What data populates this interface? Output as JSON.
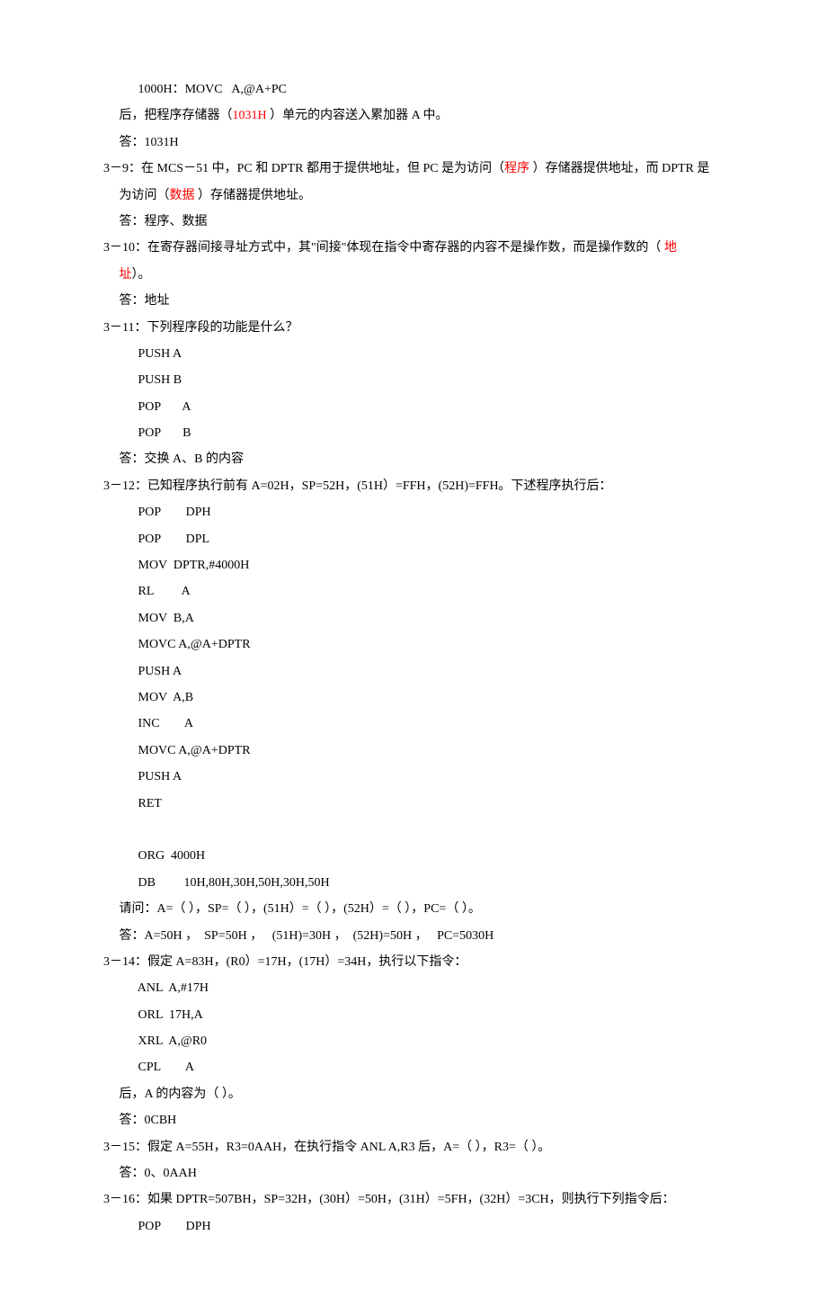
{
  "r1": {
    "indent": "           ",
    "a": "1000H：MOVC   A,@A+PC"
  },
  "r2": {
    "indent": "     ",
    "a": "后，把程序存储器（",
    "b": "1031H ",
    "c": "）单元的内容送入累加器 A 中。"
  },
  "r3": {
    "indent": "     ",
    "a": "答：1031H"
  },
  "r4": {
    "indent": "",
    "a": "3－9：在 MCS－51 中，PC 和 DPTR 都用于提供地址，但 PC 是为访问（",
    "b": "程序 ",
    "c": "）存储器提供地址，而 DPTR 是"
  },
  "r5": {
    "indent": "     ",
    "a": "为访问（",
    "b": "数据 ",
    "c": "）存储器提供地址。"
  },
  "r6": {
    "indent": "     ",
    "a": "答：程序、数据"
  },
  "r7": {
    "indent": "",
    "a": "3－10：在寄存器间接寻址方式中，其\"间接\"体现在指令中寄存器的内容不是操作数，而是操作数的（ ",
    "b": "地"
  },
  "r8": {
    "indent": "     ",
    "a": "址",
    "b": "）。"
  },
  "r9": {
    "indent": "     ",
    "a": "答：地址"
  },
  "r10": {
    "indent": "",
    "a": "3－11：下列程序段的功能是什么？"
  },
  "r11": {
    "indent": "           ",
    "a": "PUSH A"
  },
  "r12": {
    "indent": "           ",
    "a": "PUSH B"
  },
  "r13": {
    "indent": "           ",
    "a": "POP       A"
  },
  "r14": {
    "indent": "           ",
    "a": "POP       B"
  },
  "r15": {
    "indent": "     ",
    "a": "答：交换 A、B 的内容"
  },
  "r16": {
    "indent": "",
    "a": "3－12：已知程序执行前有 A=02H，SP=52H，(51H）=FFH，(52H)=FFH。下述程序执行后："
  },
  "r17": {
    "indent": "           ",
    "a": "POP        DPH"
  },
  "r18": {
    "indent": "           ",
    "a": "POP        DPL"
  },
  "r19": {
    "indent": "           ",
    "a": "MOV  DPTR,#4000H"
  },
  "r20": {
    "indent": "           ",
    "a": "RL         A"
  },
  "r21": {
    "indent": "           ",
    "a": "MOV  B,A"
  },
  "r22": {
    "indent": "           ",
    "a": "MOVC A,@A+DPTR"
  },
  "r23": {
    "indent": "           ",
    "a": "PUSH A"
  },
  "r24": {
    "indent": "           ",
    "a": "MOV  A,B"
  },
  "r25": {
    "indent": "           ",
    "a": "INC        A"
  },
  "r26": {
    "indent": "           ",
    "a": "MOVC A,@A+DPTR"
  },
  "r27": {
    "indent": "           ",
    "a": "PUSH A"
  },
  "r28": {
    "indent": "           ",
    "a": "RET"
  },
  "r29": {
    "indent": "           ",
    "a": ""
  },
  "r30": {
    "indent": "           ",
    "a": "ORG  4000H"
  },
  "r31": {
    "indent": "           ",
    "a": "DB         10H,80H,30H,50H,30H,50H"
  },
  "r32": {
    "indent": "     ",
    "a": "请问：A=（ ），SP=（ ），(51H）=（ ），(52H）=（ ），PC=（ ）。"
  },
  "r33": {
    "indent": "     ",
    "a": "答：A=50H ，  SP=50H ，   (51H)=30H ，  (52H)=50H ，   PC=5030H"
  },
  "r34": {
    "indent": "",
    "a": "3－14：假定 A=83H，(R0）=17H，(17H）=34H，执行以下指令："
  },
  "r35": {
    "indent": "           ",
    "a": "ANL  A,#17H"
  },
  "r36": {
    "indent": "           ",
    "a": "ORL  17H,A"
  },
  "r37": {
    "indent": "           ",
    "a": "XRL  A,@R0"
  },
  "r38": {
    "indent": "           ",
    "a": "CPL        A"
  },
  "r39": {
    "indent": "     ",
    "a": "后，A 的内容为（ ）。"
  },
  "r40": {
    "indent": "     ",
    "a": "答：0CBH"
  },
  "r41": {
    "indent": "",
    "a": "3－15：假定 A=55H，R3=0AAH，在执行指令 ANL A,R3 后，A=（ ），R3=（ ）。"
  },
  "r42": {
    "indent": "     ",
    "a": "答：0、0AAH"
  },
  "r43": {
    "indent": "",
    "a": "3－16：如果 DPTR=507BH，SP=32H，(30H）=50H，(31H）=5FH，(32H）=3CH，则执行下列指令后："
  },
  "r44": {
    "indent": "           ",
    "a": "POP        DPH"
  }
}
